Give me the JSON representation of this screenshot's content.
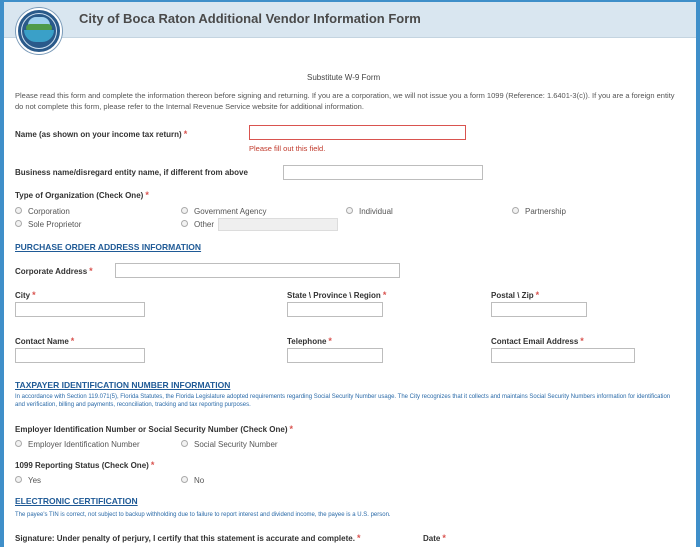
{
  "header": {
    "title": "City of Boca Raton Additional Vendor Information Form",
    "seal_icon": "city-seal-icon"
  },
  "form": {
    "subtitle": "Substitute W-9 Form",
    "intro": "Please read this form and complete the information thereon before signing and returning. If you are a corporation, we will not issue you a form 1099 (Reference: 1.6401-3(c)). If you are a foreign entity do not complete this form, please refer to the Internal Revenue Service website for additional information.",
    "name": {
      "label": "Name (as shown on your income tax return)",
      "required": "*",
      "value": "",
      "error": "Please fill out this field."
    },
    "business_name": {
      "label": "Business name/disregard entity name, if different from above",
      "value": ""
    },
    "org_type": {
      "label": "Type of Organization (Check One)",
      "required": "*",
      "options": [
        "Corporation",
        "Government Agency",
        "Individual",
        "Partnership",
        "Sole Proprietor",
        "Other"
      ],
      "other_value": ""
    },
    "po_section": {
      "title": "PURCHASE ORDER ADDRESS INFORMATION",
      "corporate_address": {
        "label": "Corporate Address",
        "required": "*",
        "value": ""
      },
      "city": {
        "label": "City",
        "required": "*",
        "value": ""
      },
      "state": {
        "label": "State \\ Province \\ Region",
        "required": "*",
        "value": ""
      },
      "zip": {
        "label": "Postal \\ Zip",
        "required": "*",
        "value": ""
      },
      "contact_name": {
        "label": "Contact Name",
        "required": "*",
        "value": ""
      },
      "telephone": {
        "label": "Telephone",
        "required": "*",
        "value": ""
      },
      "contact_email": {
        "label": "Contact Email Address",
        "required": "*",
        "value": ""
      }
    },
    "tin_section": {
      "title": "TAXPAYER IDENTIFICATION NUMBER INFORMATION",
      "notice": "In accordance with Section 119.071(5), Florida Statutes, the Florida Legislature adopted requirements regarding Social Security Number usage. The City recognizes that it collects and maintains Social Security Numbers information for identification and verification, billing and payments, reconciliation, tracking and tax reporting purposes.",
      "ein_ssn": {
        "label": "Employer Identification Number or Social Security Number (Check One)",
        "required": "*",
        "options": [
          "Employer Identification Number",
          "Social Security Number"
        ]
      },
      "reporting": {
        "label": "1099 Reporting Status (Check One)",
        "required": "*",
        "options": [
          "Yes",
          "No"
        ]
      }
    },
    "cert_section": {
      "title": "ELECTRONIC CERTIFICATION",
      "notice": "The payee's TIN is correct, not subject to backup withholding due to failure to report interest and dividend income, the payee is a U.S. person.",
      "signature_label": "Signature: Under penalty of perjury, I certify that this statement is accurate and complete.",
      "signature_required": "*",
      "date_label": "Date",
      "date_required": "*"
    }
  }
}
